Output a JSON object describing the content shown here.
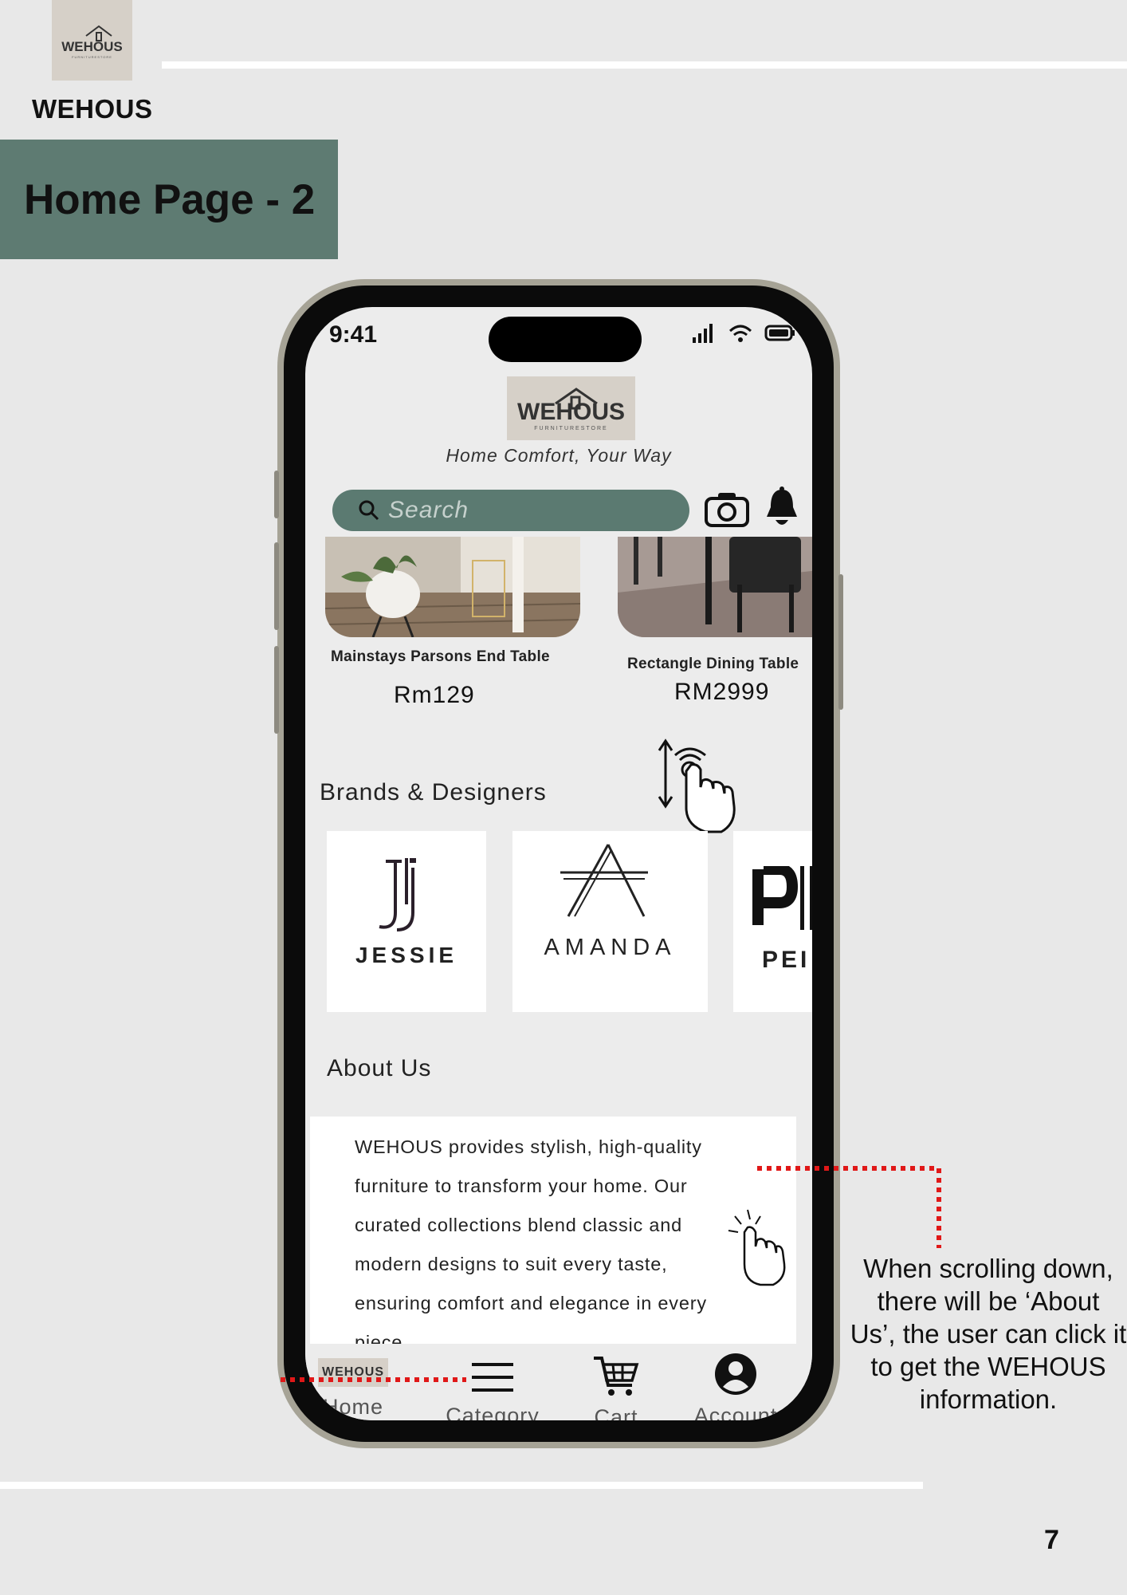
{
  "page": {
    "brand_name": "WEHOUS",
    "title": "Home Page - 2",
    "page_number": "7"
  },
  "logo": {
    "text": "WEHOUS",
    "subtext": "FURNITURESTORE"
  },
  "status_bar": {
    "time": "9:41"
  },
  "app": {
    "tagline": "Home Comfort, Your Way",
    "search_placeholder": "Search"
  },
  "products": [
    {
      "name": "Mainstays Parsons End Table",
      "price": "Rm129"
    },
    {
      "name": "Rectangle Dining Table",
      "price": "RM2999"
    }
  ],
  "brands": {
    "heading": "Brands & Designers",
    "items": [
      {
        "name": "JESSIE"
      },
      {
        "name": "AMANDA"
      },
      {
        "name": "PEI"
      }
    ]
  },
  "about": {
    "heading": "About Us",
    "lines": [
      "WEHOUS provides stylish, high-quality",
      "furniture to transform your home. Our",
      "curated collections blend classic and",
      "modern designs to suit every taste,",
      "ensuring comfort and elegance in every",
      "piece......"
    ]
  },
  "tabs": [
    {
      "label": "Home"
    },
    {
      "label": "Category"
    },
    {
      "label": "Cart"
    },
    {
      "label": "Account"
    }
  ],
  "annotation": {
    "lines": [
      "When scrolling down,",
      "there will be ‘About",
      "Us’, the user can click it",
      "to get the WEHOUS",
      "information."
    ]
  },
  "colors": {
    "accent": "#5e7b72",
    "search": "#5b7a71",
    "annotation_dots": "#e01818"
  }
}
